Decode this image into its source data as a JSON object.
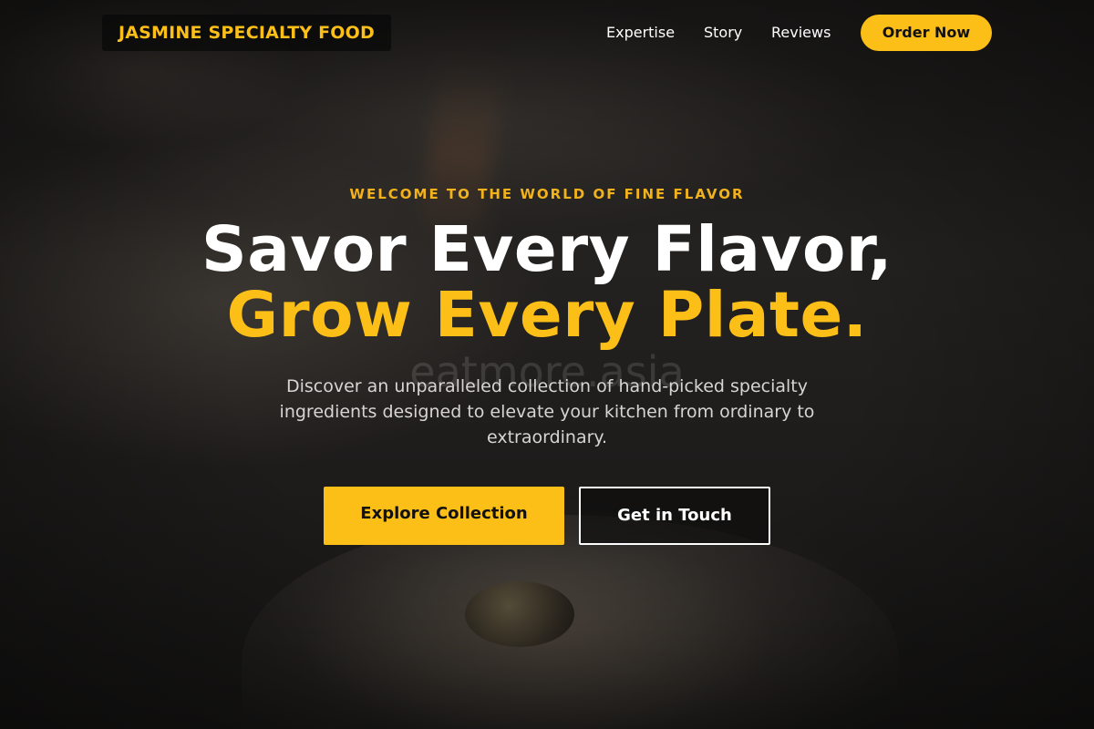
{
  "header": {
    "brand": "JASMINE SPECIALTY FOOD",
    "nav": [
      {
        "label": "Expertise"
      },
      {
        "label": "Story"
      },
      {
        "label": "Reviews"
      }
    ],
    "cta_label": "Order Now"
  },
  "hero": {
    "eyebrow": "WELCOME TO THE WORLD OF FINE FLAVOR",
    "headline_line1": "Savor Every Flavor,",
    "headline_line2": "Grow Every Plate.",
    "watermark": "eatmore.asia",
    "subtext": "Discover an unparalleled collection of hand-picked specialty ingredients designed to elevate your kitchen from ordinary to extraordinary.",
    "primary_button": "Explore Collection",
    "secondary_button": "Get in Touch"
  },
  "colors": {
    "accent": "#fbbf17",
    "background": "#151515",
    "text": "#ffffff"
  }
}
